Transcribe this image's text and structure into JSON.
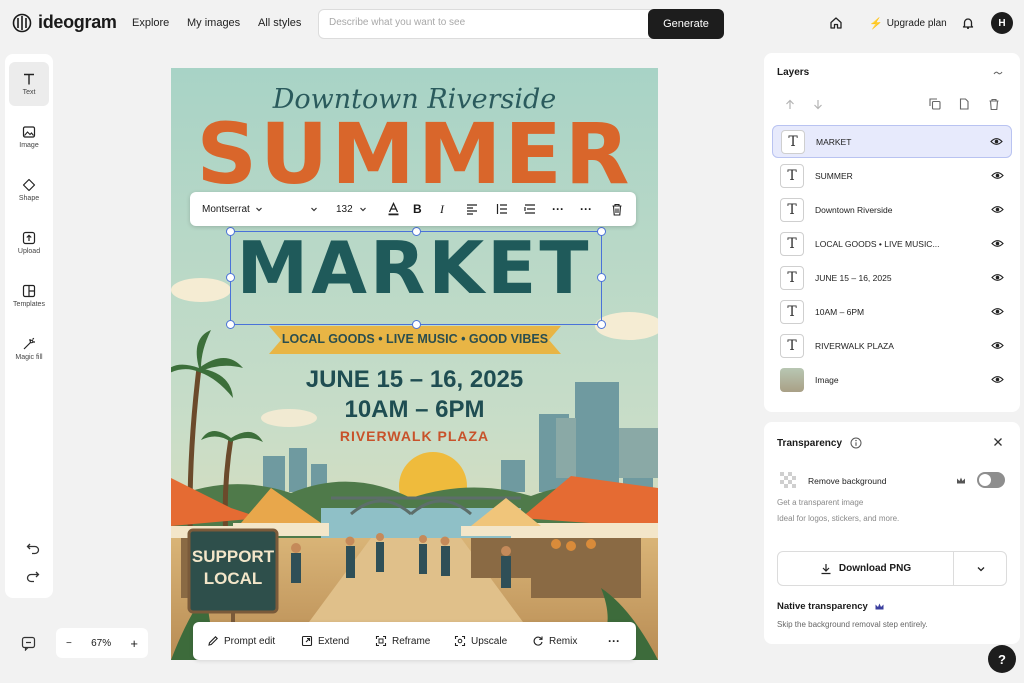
{
  "app": {
    "logo_text": "ideogram"
  },
  "nav": {
    "explore": "Explore",
    "my_images": "My images",
    "all_styles": "All styles"
  },
  "search": {
    "placeholder": "Describe what you want to see",
    "button": "Generate"
  },
  "header": {
    "upgrade": "Upgrade plan",
    "avatar_initial": "H"
  },
  "tools": [
    {
      "label": "Text",
      "icon": "text-icon"
    },
    {
      "label": "Image",
      "icon": "image-icon"
    },
    {
      "label": "Shape",
      "icon": "shape-icon"
    },
    {
      "label": "Upload",
      "icon": "upload-icon"
    },
    {
      "label": "Templates",
      "icon": "templates-icon"
    },
    {
      "label": "Magic fill",
      "icon": "magic-fill-icon"
    }
  ],
  "zoom": {
    "minus": "−",
    "value": "67%",
    "plus": "+"
  },
  "text_toolbar": {
    "font": "Montserrat",
    "size": "132"
  },
  "poster": {
    "headline_script": "Downtown Riverside",
    "title_1": "SUMMER",
    "title_2": "MARKET",
    "banner": "LOCAL GOODS • LIVE MUSIC • GOOD VIBES",
    "dates": "JUNE 15 – 16, 2025",
    "hours": "10AM – 6PM",
    "place": "RIVERWALK PLAZA",
    "sign_line1": "SUPPORT",
    "sign_line2": "LOCAL"
  },
  "actions": [
    "Prompt edit",
    "Extend",
    "Reframe",
    "Upscale",
    "Remix"
  ],
  "layers": {
    "title": "Layers",
    "items": [
      {
        "name": "MARKET",
        "type": "text"
      },
      {
        "name": "SUMMER",
        "type": "text"
      },
      {
        "name": "Downtown Riverside",
        "type": "text"
      },
      {
        "name": "LOCAL GOODS • LIVE MUSIC...",
        "type": "text"
      },
      {
        "name": "JUNE 15 – 16, 2025",
        "type": "text"
      },
      {
        "name": "10AM – 6PM",
        "type": "text"
      },
      {
        "name": "RIVERWALK PLAZA",
        "type": "text"
      },
      {
        "name": "Image",
        "type": "image"
      }
    ]
  },
  "transparency": {
    "title": "Transparency",
    "remove_bg": "Remove background",
    "desc1": "Get a transparent image",
    "desc2": "Ideal for logos, stickers, and more.",
    "download": "Download PNG",
    "native_title": "Native transparency",
    "native_desc": "Skip the background removal step entirely."
  },
  "colors": {
    "accent_blue": "#4a72d9",
    "title_orange": "#d9662b",
    "title_teal": "#1f5a5a",
    "banner_yellow": "#e8b545"
  }
}
